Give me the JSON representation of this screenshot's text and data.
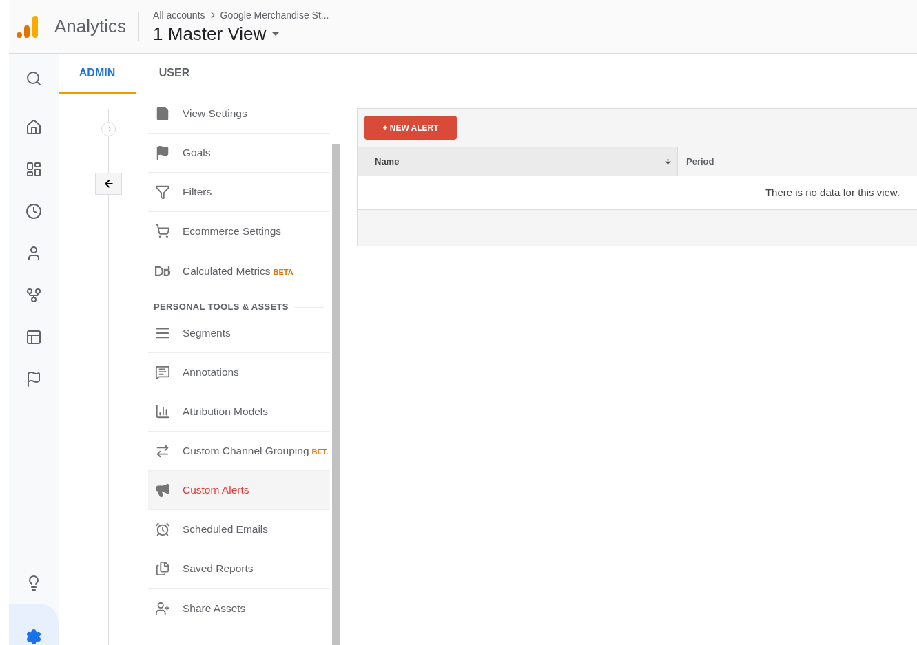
{
  "header": {
    "product": "Analytics",
    "breadcrumb": [
      {
        "label": "All accounts"
      },
      {
        "label": "Google Merchandise St..."
      }
    ],
    "view": "1 Master View"
  },
  "nav_rail": [
    {
      "selected": false
    },
    {
      "selected": false
    },
    {
      "selected": false
    },
    {
      "selected": false
    },
    {
      "selected": false
    },
    {
      "selected": false
    },
    {
      "selected": false
    },
    {
      "selected": false
    },
    {
      "selected": false
    },
    {
      "selected": true
    }
  ],
  "tabs": [
    {
      "label": "ADMIN",
      "selected": true
    },
    {
      "label": "USER",
      "selected": false
    }
  ],
  "menu": [
    {
      "kind": "item",
      "label": "View Settings",
      "selected": false
    },
    {
      "kind": "item",
      "label": "Goals",
      "selected": false
    },
    {
      "kind": "item",
      "label": "Filters",
      "selected": false
    },
    {
      "kind": "item",
      "label": "Ecommerce Settings",
      "selected": false
    },
    {
      "kind": "item",
      "label": "Calculated Metrics",
      "badge": "BETA",
      "selected": false
    },
    {
      "kind": "section",
      "label": "PERSONAL TOOLS & ASSETS"
    },
    {
      "kind": "item",
      "label": "Segments",
      "selected": false
    },
    {
      "kind": "item",
      "label": "Annotations",
      "selected": false
    },
    {
      "kind": "item",
      "label": "Attribution Models",
      "selected": false
    },
    {
      "kind": "item",
      "label": "Custom Channel Grouping",
      "badge": "BET.",
      "selected": false
    },
    {
      "kind": "item",
      "label": "Custom Alerts",
      "selected": true
    },
    {
      "kind": "item",
      "label": "Scheduled Emails",
      "selected": false
    },
    {
      "kind": "item",
      "label": "Saved Reports",
      "selected": false
    },
    {
      "kind": "item",
      "label": "Share Assets",
      "selected": false
    }
  ],
  "alerts": {
    "button": "+ NEW ALERT",
    "columns": [
      {
        "label": "Name",
        "sorted": true
      },
      {
        "label": "Period",
        "sorted": false
      }
    ],
    "empty_message": "There is no data for this view."
  }
}
